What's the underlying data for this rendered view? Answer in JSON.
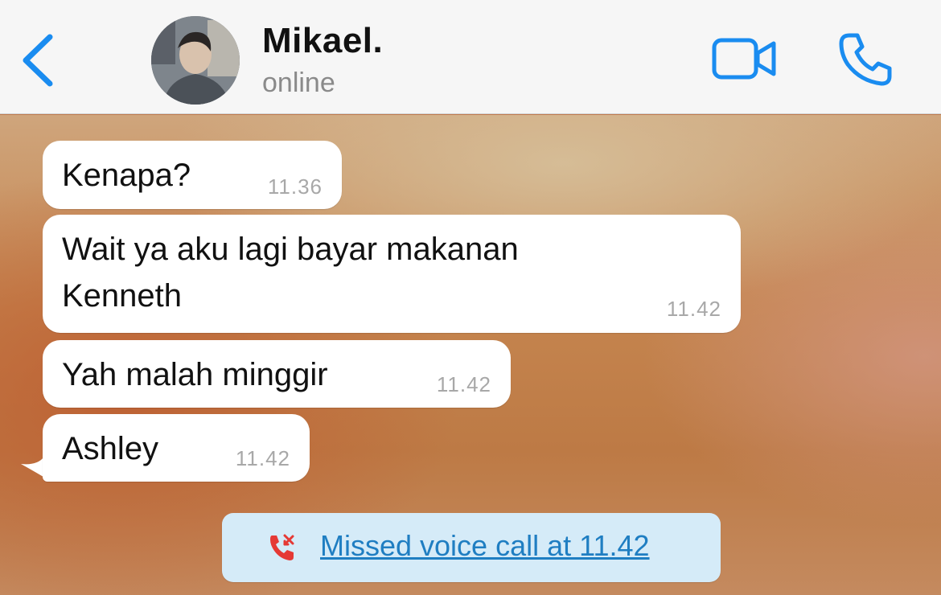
{
  "header": {
    "back_icon": "chevron-left-icon",
    "contact_name": "Mikael.",
    "status": "online",
    "video_icon": "video-camera-icon",
    "call_icon": "phone-icon",
    "accent_color": "#1a8cf0"
  },
  "messages": [
    {
      "text": "Kenapa?",
      "time": "11.36"
    },
    {
      "text": "Wait ya aku lagi bayar makanan\nKenneth",
      "time": "11.42"
    },
    {
      "text": "Yah malah minggir",
      "time": "11.42"
    },
    {
      "text": "Ashley",
      "time": "11.42"
    }
  ],
  "missed_call": {
    "icon": "missed-call-icon",
    "text": "Missed voice call at 11.42",
    "icon_color": "#e53935",
    "link_color": "#1f7ec2"
  }
}
